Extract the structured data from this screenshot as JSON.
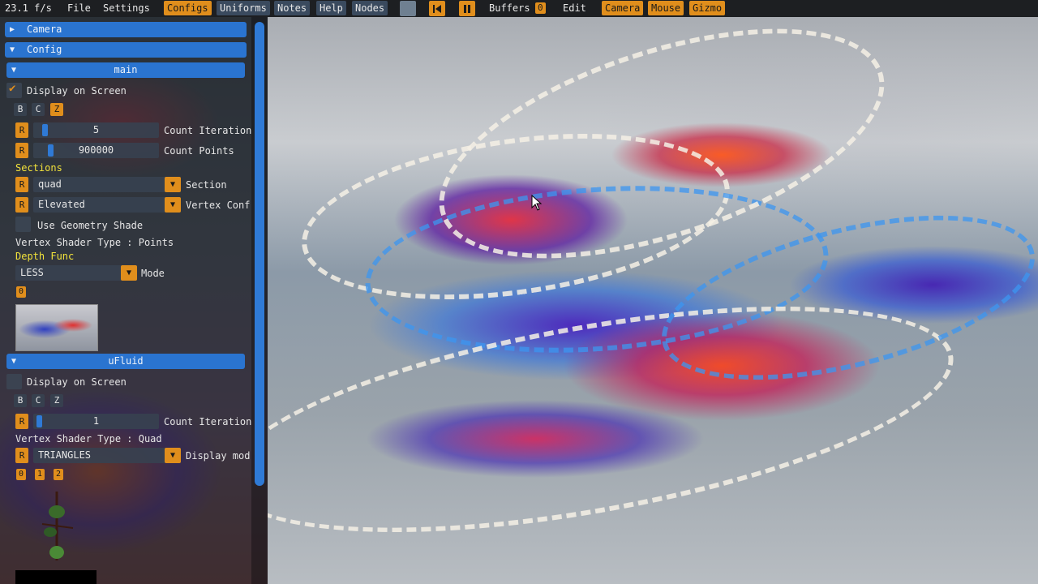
{
  "menubar": {
    "fps": "23.1 f/s",
    "file": "File",
    "settings": "Settings",
    "configs": "Configs",
    "uniforms": "Uniforms",
    "notes": "Notes",
    "help": "Help",
    "nodes": "Nodes",
    "buffers": "Buffers",
    "buffers_count": "0",
    "edit": "Edit",
    "camera": "Camera",
    "mouse": "Mouse",
    "gizmo": "Gizmo",
    "accent": "#e08e1c",
    "icons": [
      "skip-back-icon",
      "pause-icon"
    ]
  },
  "panel": {
    "camera_header": "Camera",
    "config_header": "Config",
    "main": {
      "header": "main",
      "display_on_screen": "Display on Screen",
      "display_checked": true,
      "b": "B",
      "c": "C",
      "z": "Z",
      "r": "R",
      "count_iteration_value": "5",
      "count_iteration_label": "Count Iteration",
      "count_points_value": "900000",
      "count_points_label": "Count Points",
      "sections_label": "Sections",
      "section_value": "quad",
      "section_label": "Section",
      "vertex_conf_value": "Elevated",
      "vertex_conf_label": "Vertex Conf",
      "use_geometry_shader": "Use Geometry Shade",
      "vertex_shader_type": "Vertex Shader Type : Points",
      "depth_func_label": "Depth Func",
      "depth_mode_value": "LESS",
      "depth_mode_label": "Mode",
      "chip_0": "0"
    },
    "ufluid": {
      "header": "uFluid",
      "display_on_screen": "Display on Screen",
      "display_checked": false,
      "b": "B",
      "c": "C",
      "z": "Z",
      "r": "R",
      "count_iteration_value": "1",
      "count_iteration_label": "Count Iteration",
      "vertex_shader_type": "Vertex Shader Type : Quad",
      "display_mode_value": "TRIANGLES",
      "display_mode_label": "Display mod",
      "chips": [
        "0",
        "1",
        "2"
      ]
    }
  }
}
